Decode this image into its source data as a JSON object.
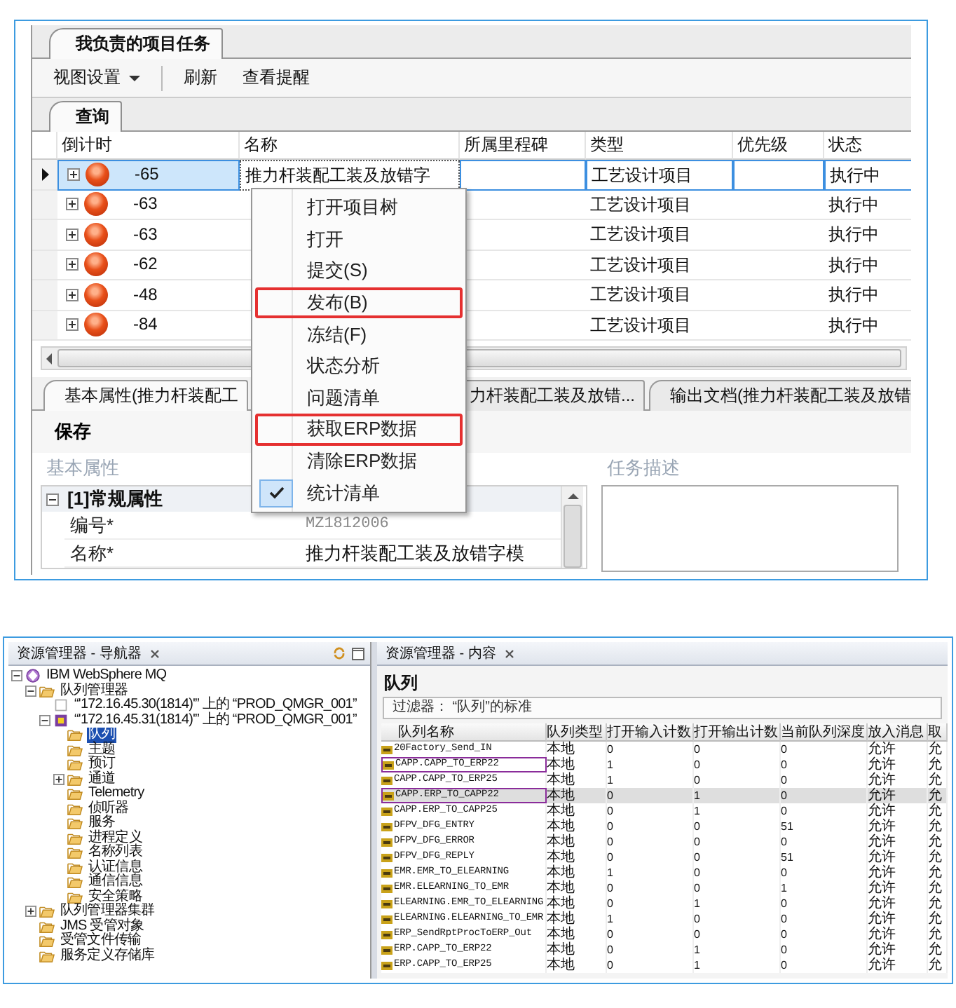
{
  "top": {
    "doc_tab": {
      "label": "我负责的项目任务",
      "selected": true
    },
    "toolbar": [
      {
        "kind": "dropdown",
        "label": "视图设置"
      },
      {
        "kind": "button",
        "label": "刷新"
      },
      {
        "kind": "button",
        "label": "查看提醒"
      }
    ],
    "query_tab": {
      "label": "查询",
      "selected": true
    },
    "grid": {
      "columns": [
        "倒计时",
        "名称",
        "所属里程碑",
        "类型",
        "优先级",
        "状态"
      ],
      "rows": [
        {
          "countdown": "-65",
          "name": "推力杆装配工装及放错字",
          "type": "工艺设计项目",
          "status": "执行中",
          "selected": true
        },
        {
          "countdown": "-63",
          "type": "工艺设计项目",
          "status": "执行中",
          "selected": false
        },
        {
          "countdown": "-63",
          "type": "工艺设计项目",
          "status": "执行中",
          "selected": false
        },
        {
          "countdown": "-62",
          "type": "工艺设计项目",
          "status": "执行中",
          "selected": false
        },
        {
          "countdown": "-48",
          "type": "工艺设计项目",
          "status": "执行中",
          "selected": false
        },
        {
          "countdown": "-84",
          "type": "工艺设计项目",
          "status": "执行中",
          "selected": false
        }
      ]
    },
    "detail_tabs": [
      {
        "label": "基本属性(推力杆装配工",
        "selected": true
      },
      {
        "label": "力杆装配工装及放错...",
        "selected": false
      },
      {
        "label": "输出文档(推力杆装配工装及放错",
        "selected": false
      }
    ],
    "save_label": "保存",
    "properties": {
      "title": "基本属性",
      "category": "[1]常规属性",
      "expanded": true,
      "rows": [
        {
          "label": "编号*",
          "value": "MZ1812006",
          "readonly": true
        },
        {
          "label": "名称*",
          "value": "推力杆装配工装及放错字模",
          "readonly": false
        }
      ]
    },
    "description": {
      "title": "任务描述"
    },
    "context_menu": [
      {
        "label": "打开项目树",
        "checked": false,
        "highlighted": false
      },
      {
        "label": "打开",
        "checked": false,
        "highlighted": false
      },
      {
        "label": "提交(S)",
        "checked": false,
        "highlighted": false
      },
      {
        "label": "发布(B)",
        "checked": false,
        "highlighted": true
      },
      {
        "label": "冻结(F)",
        "checked": false,
        "highlighted": false
      },
      {
        "label": "状态分析",
        "checked": false,
        "highlighted": false
      },
      {
        "label": "问题清单",
        "checked": false,
        "highlighted": false
      },
      {
        "label": "获取ERP数据",
        "checked": false,
        "highlighted": true
      },
      {
        "label": "清除ERP数据",
        "checked": false,
        "highlighted": false
      },
      {
        "label": "统计清单",
        "checked": true,
        "highlighted": false
      }
    ]
  },
  "bottom": {
    "navigator": {
      "title": "资源管理器 - 导航器",
      "tree": [
        {
          "label": "IBM WebSphere MQ",
          "kind": "mq",
          "expanded": true,
          "selected": false,
          "children": [
            {
              "label": "队列管理器",
              "kind": "folder",
              "expanded": true,
              "selected": false,
              "children": [
                {
                  "label": "“'172.16.45.30(1814)'” 上的 “PROD_QMGR_001”",
                  "kind": "qmgr-stopped",
                  "selected": false
                },
                {
                  "label": "“'172.16.45.31(1814)'” 上的 “PROD_QMGR_001”",
                  "kind": "qmgr-running",
                  "expanded": true,
                  "selected": false,
                  "children": [
                    {
                      "label": "队列",
                      "kind": "folder",
                      "selected": true
                    },
                    {
                      "label": "主题",
                      "kind": "folder",
                      "selected": false
                    },
                    {
                      "label": "预订",
                      "kind": "folder",
                      "selected": false
                    },
                    {
                      "label": "通道",
                      "kind": "folder",
                      "expanded": false,
                      "selected": false
                    },
                    {
                      "label": "Telemetry",
                      "kind": "folder",
                      "selected": false
                    },
                    {
                      "label": "侦听器",
                      "kind": "folder",
                      "selected": false
                    },
                    {
                      "label": "服务",
                      "kind": "folder",
                      "selected": false
                    },
                    {
                      "label": "进程定义",
                      "kind": "folder",
                      "selected": false
                    },
                    {
                      "label": "名称列表",
                      "kind": "folder",
                      "selected": false
                    },
                    {
                      "label": "认证信息",
                      "kind": "folder",
                      "selected": false
                    },
                    {
                      "label": "通信信息",
                      "kind": "folder",
                      "selected": false
                    },
                    {
                      "label": "安全策略",
                      "kind": "folder",
                      "selected": false
                    }
                  ]
                }
              ]
            },
            {
              "label": "队列管理器集群",
              "kind": "folder",
              "expanded": false,
              "selected": false
            },
            {
              "label": "JMS 受管对象",
              "kind": "folder",
              "selected": false
            },
            {
              "label": "受管文件传输",
              "kind": "folder",
              "selected": false
            },
            {
              "label": "服务定义存储库",
              "kind": "folder",
              "selected": false
            }
          ]
        }
      ]
    },
    "content": {
      "title": "资源管理器 - 内容",
      "heading": "队列",
      "filter": "过滤器： “队列”的标准",
      "columns": [
        "队列名称",
        "队列类型",
        "打开输入计数",
        "打开输出计数",
        "当前队列深度",
        "放入消息",
        "取"
      ],
      "rows": [
        {
          "name": "20Factory_Send_IN",
          "type": "本地",
          "input": "0",
          "output": "0",
          "depth": "0",
          "put": "允许",
          "get": "允",
          "selected": false,
          "highlighted": false
        },
        {
          "name": "CAPP.CAPP_TO_ERP22",
          "type": "本地",
          "input": "1",
          "output": "0",
          "depth": "0",
          "put": "允许",
          "get": "允",
          "selected": false,
          "highlighted": true
        },
        {
          "name": "CAPP.CAPP_TO_ERP25",
          "type": "本地",
          "input": "1",
          "output": "0",
          "depth": "0",
          "put": "允许",
          "get": "允",
          "selected": false,
          "highlighted": false
        },
        {
          "name": "CAPP.ERP_TO_CAPP22",
          "type": "本地",
          "input": "0",
          "output": "1",
          "depth": "0",
          "put": "允许",
          "get": "允",
          "selected": true,
          "highlighted": true
        },
        {
          "name": "CAPP.ERP_TO_CAPP25",
          "type": "本地",
          "input": "0",
          "output": "1",
          "depth": "0",
          "put": "允许",
          "get": "允",
          "selected": false,
          "highlighted": false
        },
        {
          "name": "DFPV_DFG_ENTRY",
          "type": "本地",
          "input": "0",
          "output": "0",
          "depth": "51",
          "put": "允许",
          "get": "允",
          "selected": false,
          "highlighted": false
        },
        {
          "name": "DFPV_DFG_ERROR",
          "type": "本地",
          "input": "0",
          "output": "0",
          "depth": "0",
          "put": "允许",
          "get": "允",
          "selected": false,
          "highlighted": false
        },
        {
          "name": "DFPV_DFG_REPLY",
          "type": "本地",
          "input": "0",
          "output": "0",
          "depth": "51",
          "put": "允许",
          "get": "允",
          "selected": false,
          "highlighted": false
        },
        {
          "name": "EMR.EMR_TO_ELEARNING",
          "type": "本地",
          "input": "1",
          "output": "0",
          "depth": "0",
          "put": "允许",
          "get": "允",
          "selected": false,
          "highlighted": false
        },
        {
          "name": "EMR.ELEARNING_TO_EMR",
          "type": "本地",
          "input": "0",
          "output": "0",
          "depth": "1",
          "put": "允许",
          "get": "允",
          "selected": false,
          "highlighted": false
        },
        {
          "name": "ELEARNING.EMR_TO_ELEARNING",
          "type": "本地",
          "input": "0",
          "output": "1",
          "depth": "0",
          "put": "允许",
          "get": "允",
          "selected": false,
          "highlighted": false
        },
        {
          "name": "ELEARNING.ELEARNING_TO_EMR",
          "type": "本地",
          "input": "1",
          "output": "0",
          "depth": "0",
          "put": "允许",
          "get": "允",
          "selected": false,
          "highlighted": false
        },
        {
          "name": "ERP_SendRptProcToERP_Out",
          "type": "本地",
          "input": "0",
          "output": "0",
          "depth": "0",
          "put": "允许",
          "get": "允",
          "selected": false,
          "highlighted": false
        },
        {
          "name": "ERP.CAPP_TO_ERP22",
          "type": "本地",
          "input": "0",
          "output": "1",
          "depth": "0",
          "put": "允许",
          "get": "允",
          "selected": false,
          "highlighted": false
        },
        {
          "name": "ERP.CAPP_TO_ERP25",
          "type": "本地",
          "input": "0",
          "output": "1",
          "depth": "0",
          "put": "允许",
          "get": "允",
          "selected": false,
          "highlighted": false
        }
      ]
    }
  }
}
